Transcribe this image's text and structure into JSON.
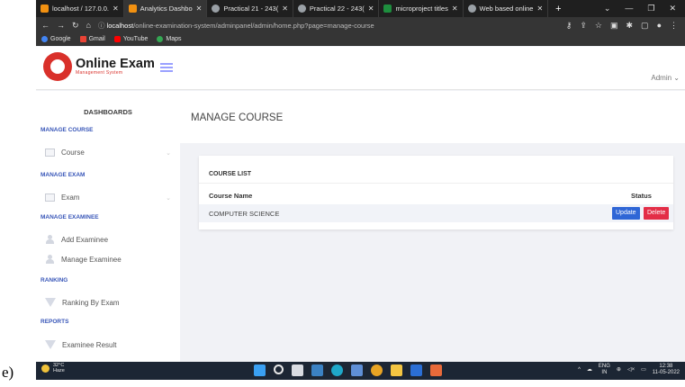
{
  "browser": {
    "tabs": [
      {
        "label": "localhost / 127.0.0.",
        "color": "#f29111",
        "active": false
      },
      {
        "label": "Analytics Dashbo",
        "color": "#f29111",
        "active": true
      },
      {
        "label": "Practical 21 - 243(",
        "color": "#9aa0a6",
        "active": false
      },
      {
        "label": "Practical 22 - 243(",
        "color": "#9aa0a6",
        "active": false
      },
      {
        "label": "microproject titles",
        "color": "#1e8e3e",
        "active": false
      },
      {
        "label": "Web based online",
        "color": "#9aa0a6",
        "active": false
      }
    ],
    "url_host": "localhost",
    "url_path": "/online-examination-system/adminpanel/admin/home.php?page=manage-course",
    "bookmarks": [
      {
        "label": "Google",
        "color": "#4285f4"
      },
      {
        "label": "Gmail",
        "color": "#ea4335"
      },
      {
        "label": "YouTube",
        "color": "#ff0000"
      },
      {
        "label": "Maps",
        "color": "#34a853"
      }
    ]
  },
  "header": {
    "logo_title": "Online Exam",
    "logo_subtitle": "Management System",
    "user_label": "Admin"
  },
  "sidebar": {
    "title": "DASHBOARDS",
    "sections": [
      {
        "heading": "MANAGE COURSE",
        "items": [
          {
            "label": "Course",
            "icon": "document-icon",
            "chevron": true
          }
        ]
      },
      {
        "heading": "MANAGE EXAM",
        "items": [
          {
            "label": "Exam",
            "icon": "document-icon",
            "chevron": true
          }
        ]
      },
      {
        "heading": "MANAGE EXAMINEE",
        "items": [
          {
            "label": "Add Examinee",
            "icon": "add-user-icon",
            "chevron": false
          },
          {
            "label": "Manage Examinee",
            "icon": "users-icon",
            "chevron": false
          }
        ]
      },
      {
        "heading": "RANKING",
        "items": [
          {
            "label": "Ranking By Exam",
            "icon": "funnel-icon",
            "chevron": false
          }
        ]
      },
      {
        "heading": "REPORTS",
        "items": [
          {
            "label": "Examinee Result",
            "icon": "funnel-icon",
            "chevron": false
          }
        ]
      }
    ]
  },
  "main": {
    "page_title": "MANAGE COURSE",
    "card_title": "COURSE LIST",
    "columns": [
      "Course Name",
      "Status"
    ],
    "rows": [
      {
        "course_name": "COMPUTER SCIENCE",
        "update_label": "Update",
        "delete_label": "Delete"
      }
    ]
  },
  "taskbar": {
    "temperature": "32°C",
    "condition": "Haze",
    "language": "ENG",
    "region": "IN",
    "time": "12:38",
    "date": "11-05-2022"
  },
  "caption": "e)",
  "colors": {
    "accent": "#3856b8",
    "update_button": "#2f66d6",
    "delete_button": "#e32e47",
    "logo_red": "#d9302a"
  }
}
